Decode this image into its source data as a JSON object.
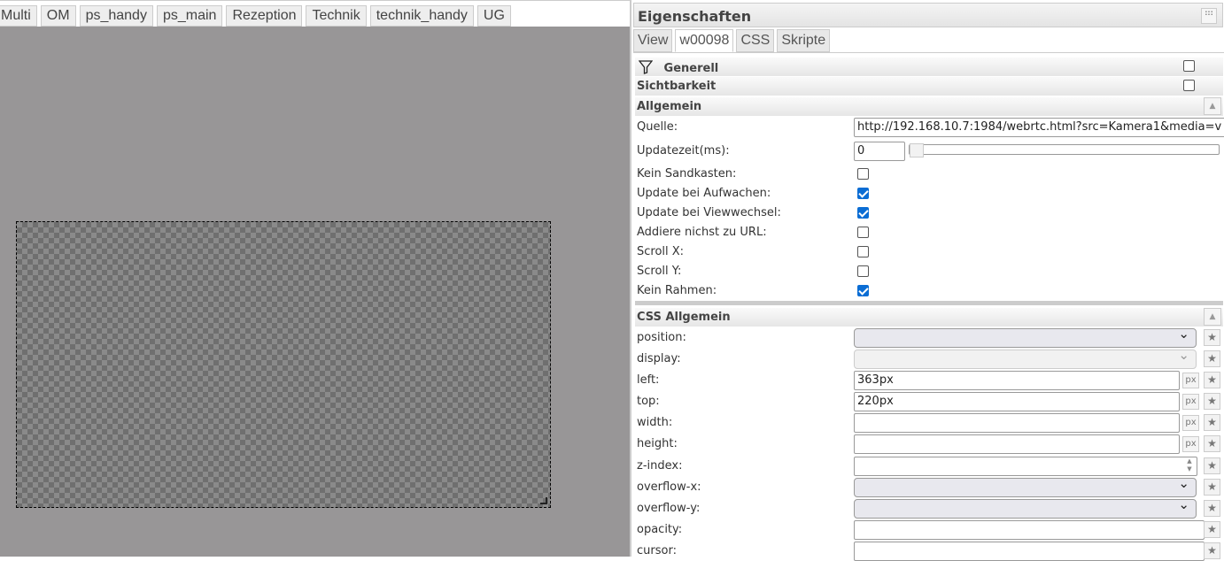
{
  "view_tabs": [
    "Multi",
    "OM",
    "ps_handy",
    "ps_main",
    "Rezeption",
    "Technik",
    "technik_handy",
    "UG"
  ],
  "panel": {
    "title": "Eigenschaften",
    "tabs": [
      "View",
      "w00098",
      "CSS",
      "Skripte"
    ],
    "sections": {
      "generell": "Generell",
      "sichtbarkeit": "Sichtbarkeit",
      "allgemein": "Allgemein",
      "css_allgemein": "CSS Allgemein"
    },
    "allgemein": {
      "quelle_label": "Quelle:",
      "quelle_value": "http://192.168.10.7:1984/webrtc.html?src=Kamera1&media=v",
      "update_label": "Updatezeit(ms):",
      "update_value": "0",
      "checks": [
        {
          "label": "Kein Sandkasten:",
          "checked": false
        },
        {
          "label": "Update bei Aufwachen:",
          "checked": true
        },
        {
          "label": "Update bei Viewwechsel:",
          "checked": true
        },
        {
          "label": "Addiere nichst zu URL:",
          "checked": false
        },
        {
          "label": "Scroll X:",
          "checked": false
        },
        {
          "label": "Scroll Y:",
          "checked": false
        },
        {
          "label": "Kein Rahmen:",
          "checked": true
        }
      ]
    },
    "css": {
      "position": "position:",
      "display": "display:",
      "left": "left:",
      "left_value": "363px",
      "top": "top:",
      "top_value": "220px",
      "width": "width:",
      "height": "height:",
      "zindex": "z-index:",
      "overflowx": "overflow-x:",
      "overflowy": "overflow-y:",
      "opacity": "opacity:",
      "cursor": "cursor:",
      "unit": "px"
    }
  }
}
